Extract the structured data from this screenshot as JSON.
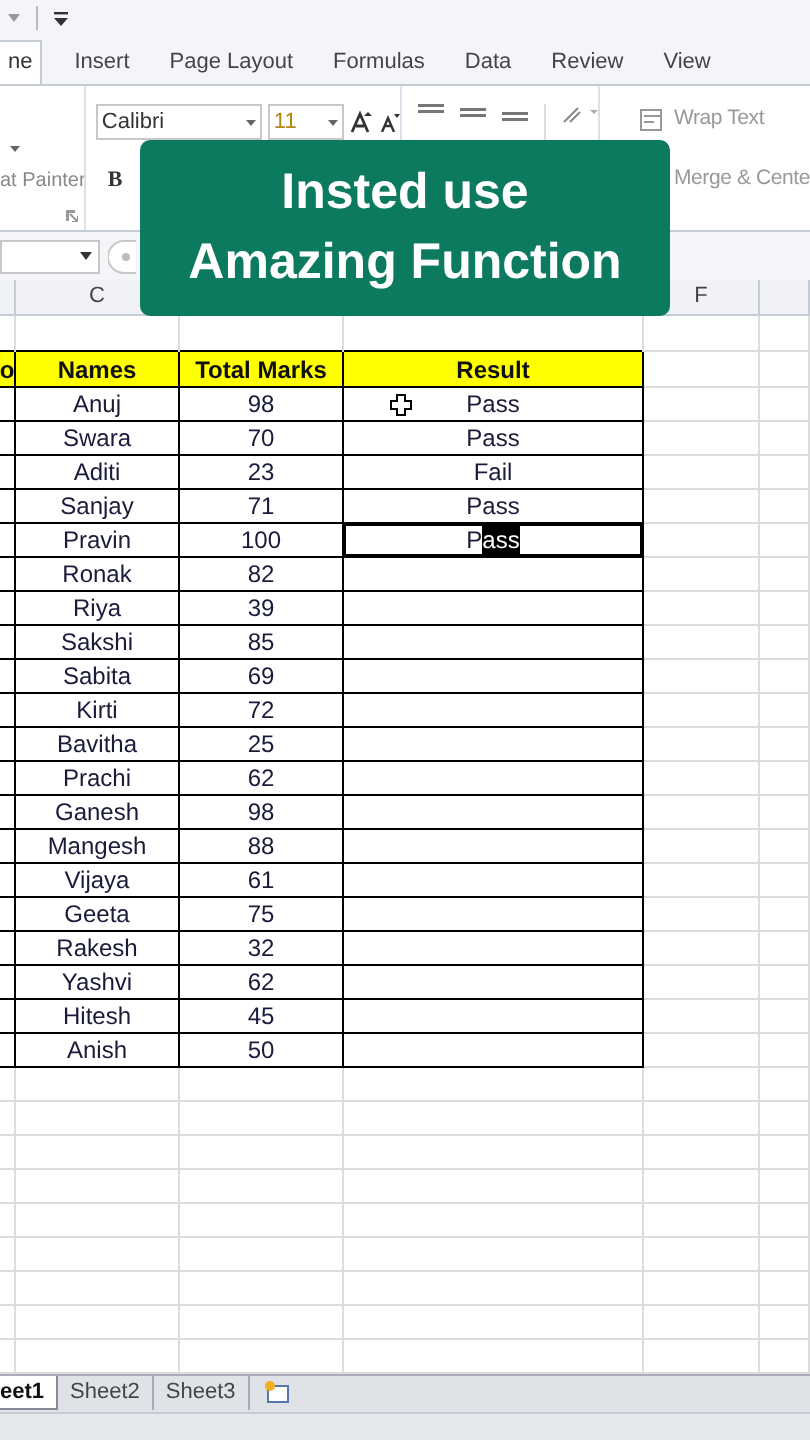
{
  "ribbon_tabs": [
    {
      "label": "ne",
      "selected": true
    },
    {
      "label": "Insert",
      "selected": false
    },
    {
      "label": "Page Layout",
      "selected": false
    },
    {
      "label": "Formulas",
      "selected": false
    },
    {
      "label": "Data",
      "selected": false
    },
    {
      "label": "Review",
      "selected": false
    },
    {
      "label": "View",
      "selected": false
    }
  ],
  "ribbon": {
    "clipboard_label": "at Painter",
    "font_name": "Calibri",
    "font_size": "11",
    "bold_label": "B",
    "wrap_text": "Wrap Text",
    "merge_center": "Merge & Cente"
  },
  "banner": {
    "text": "Insted use\nAmazing Function"
  },
  "column_headers": [
    "C",
    "F"
  ],
  "table": {
    "header": [
      "o",
      "Names",
      "Total Marks",
      "Result"
    ],
    "rows": [
      {
        "name": "Anuj",
        "marks": "98",
        "result": "Pass",
        "active": false
      },
      {
        "name": "Swara",
        "marks": "70",
        "result": "Pass",
        "active": false
      },
      {
        "name": "Aditi",
        "marks": "23",
        "result": "Fail",
        "active": false
      },
      {
        "name": "Sanjay",
        "marks": "71",
        "result": "Pass",
        "active": false
      },
      {
        "name": "Pravin",
        "marks": "100",
        "result": "P",
        "result_selected": "ass",
        "active": true
      },
      {
        "name": "Ronak",
        "marks": "82",
        "active": false
      },
      {
        "name": "Riya",
        "marks": "39",
        "active": false
      },
      {
        "name": "Sakshi",
        "marks": "85",
        "active": false
      },
      {
        "name": "Sabita",
        "marks": "69",
        "active": false
      },
      {
        "name": "Kirti",
        "marks": "72",
        "active": false
      },
      {
        "name": "Bavitha",
        "marks": "25",
        "active": false
      },
      {
        "name": "Prachi",
        "marks": "62",
        "active": false
      },
      {
        "name": "Ganesh",
        "marks": "98",
        "active": false
      },
      {
        "name": "Mangesh",
        "marks": "88",
        "active": false
      },
      {
        "name": "Vijaya",
        "marks": "61",
        "active": false
      },
      {
        "name": "Geeta",
        "marks": "75",
        "active": false
      },
      {
        "name": "Rakesh",
        "marks": "32",
        "active": false
      },
      {
        "name": "Yashvi",
        "marks": "62",
        "active": false
      },
      {
        "name": "Hitesh",
        "marks": "45",
        "active": false
      },
      {
        "name": "Anish",
        "marks": "50",
        "active": false
      }
    ]
  },
  "sheet_tabs": [
    {
      "label": "eet1",
      "selected": true
    },
    {
      "label": "Sheet2",
      "selected": false
    },
    {
      "label": "Sheet3",
      "selected": false
    }
  ]
}
